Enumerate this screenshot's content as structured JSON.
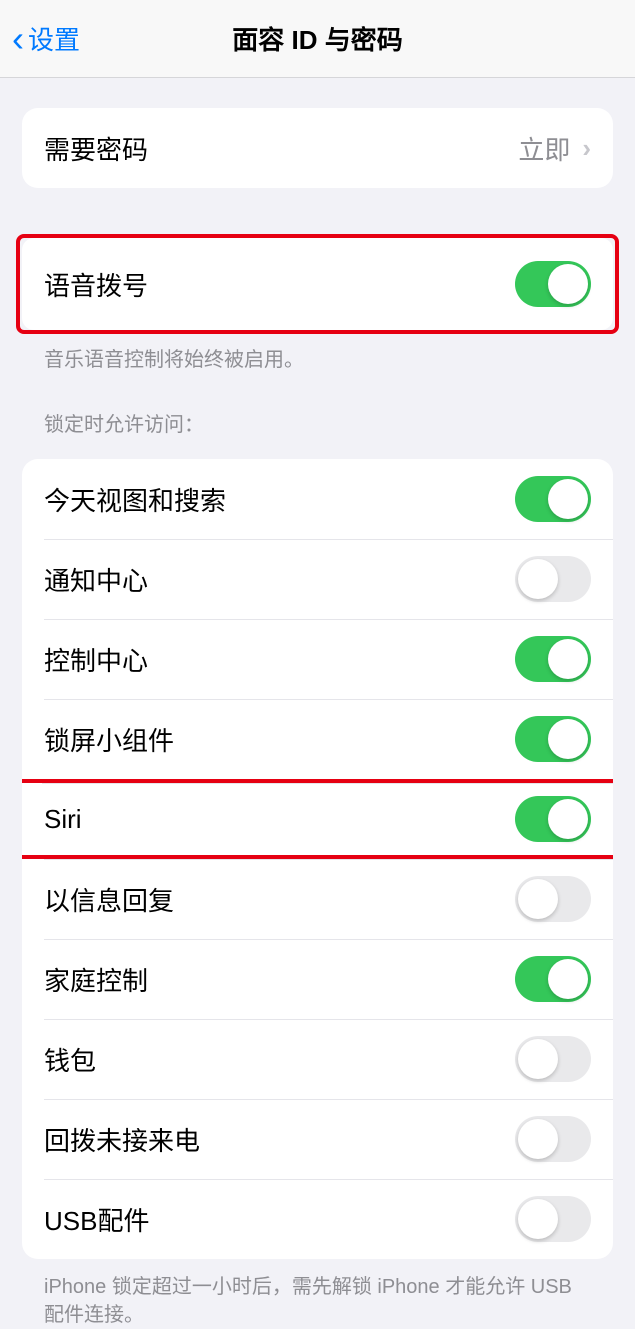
{
  "nav": {
    "back_label": "设置",
    "title": "面容 ID 与密码"
  },
  "group1": {
    "require_passcode_label": "需要密码",
    "require_passcode_value": "立即"
  },
  "group2": {
    "voice_dial_label": "语音拨号",
    "voice_dial_on": true,
    "footer": "音乐语音控制将始终被启用。"
  },
  "group3_header": "锁定时允许访问：",
  "group3": {
    "items": [
      {
        "label": "今天视图和搜索",
        "on": true,
        "highlighted": false
      },
      {
        "label": "通知中心",
        "on": false,
        "highlighted": false
      },
      {
        "label": "控制中心",
        "on": true,
        "highlighted": false
      },
      {
        "label": "锁屏小组件",
        "on": true,
        "highlighted": false
      },
      {
        "label": "Siri",
        "on": true,
        "highlighted": true
      },
      {
        "label": "以信息回复",
        "on": false,
        "highlighted": false
      },
      {
        "label": "家庭控制",
        "on": true,
        "highlighted": false
      },
      {
        "label": "钱包",
        "on": false,
        "highlighted": false
      },
      {
        "label": "回拨未接来电",
        "on": false,
        "highlighted": false
      },
      {
        "label": "USB配件",
        "on": false,
        "highlighted": false
      }
    ]
  },
  "group3_footer": "iPhone 锁定超过一小时后，需先解锁 iPhone 才能允许 USB 配件连接。"
}
